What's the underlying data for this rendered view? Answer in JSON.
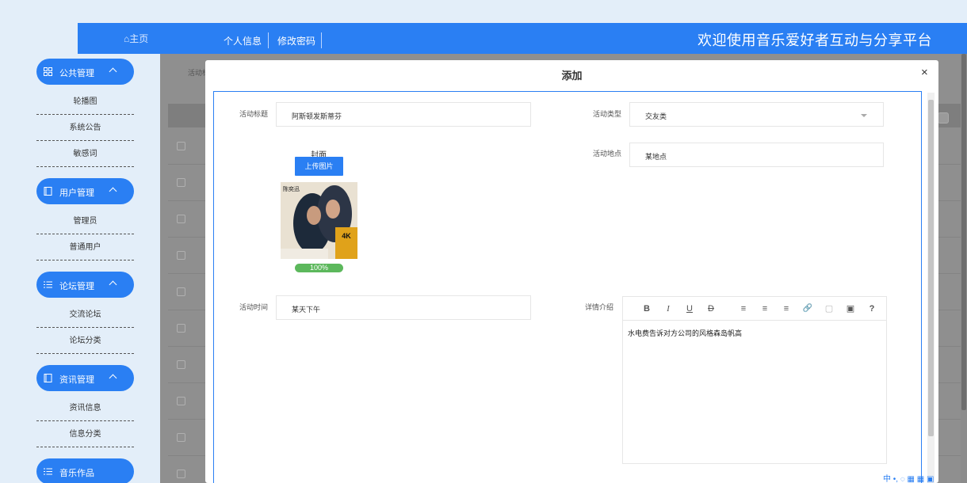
{
  "header": {
    "home_label": "⌂主页",
    "nav_items": [
      "个人信息",
      "修改密码"
    ],
    "site_title": "欢迎使用音乐爱好者互动与分享平台",
    "bar_color": "#2a7ff3"
  },
  "sidebar": {
    "groups": [
      {
        "label": "公共管理",
        "icon": "grid-icon",
        "items": [
          "轮播图",
          "系统公告",
          "敏感词"
        ]
      },
      {
        "label": "用户管理",
        "icon": "book-icon",
        "items": [
          "管理员",
          "普通用户"
        ]
      },
      {
        "label": "论坛管理",
        "icon": "list-icon",
        "items": [
          "交流论坛",
          "论坛分类"
        ]
      },
      {
        "label": "资讯管理",
        "icon": "book-icon",
        "items": [
          "资讯信息",
          "信息分类"
        ]
      },
      {
        "label": "音乐作品",
        "icon": "list-icon",
        "items": []
      }
    ]
  },
  "background_page": {
    "search_label": "活动标"
  },
  "modal": {
    "title": "添加",
    "close_symbol": "×",
    "fields": {
      "title_label": "活动标题",
      "title_value": "阿斯顿发斯蒂芬",
      "type_label": "活动类型",
      "type_value": "交友类",
      "location_label": "活动地点",
      "location_value": "某地点",
      "cover_label": "封面",
      "upload_label": "上传图片",
      "cover_image_text": "陈奕迅",
      "cover_badge_text": "4K",
      "upload_progress": "100%",
      "time_label": "活动时间",
      "time_value": "某天下午",
      "detail_label": "详情介绍",
      "detail_value": "水电费告诉对方公司的风格森岛帆高"
    },
    "editor_toolbar": [
      "B",
      "I",
      "U",
      "D",
      "≡",
      "≡",
      "≡",
      "🔗",
      "▢",
      "▣",
      "?"
    ]
  },
  "system": {
    "ime_text": "中 •, ◌ ▦ ▦ ▣"
  }
}
